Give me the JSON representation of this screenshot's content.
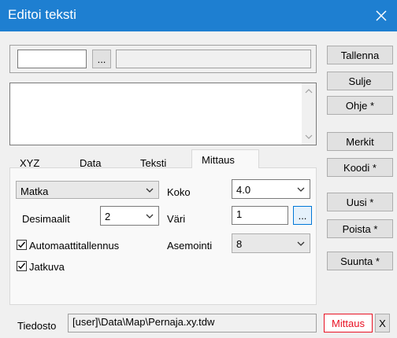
{
  "window": {
    "title": "Editoi teksti",
    "close": "✕"
  },
  "top": {
    "text_value": "",
    "browse": "...",
    "readonly_value": ""
  },
  "editor": {
    "value": ""
  },
  "tabs": [
    "XYZ",
    "Data",
    "Teksti",
    "Mittaus"
  ],
  "active_tab": "Mittaus",
  "mittaus": {
    "type_value": "Matka",
    "koko_label": "Koko",
    "koko_value": "4.0",
    "desimaalit_label": "Desimaalit",
    "desimaalit_value": "2",
    "vari_label": "Väri",
    "vari_value": "1",
    "vari_browse": "...",
    "asemointi_label": "Asemointi",
    "asemointi_value": "8",
    "auto_label": "Automaattitallennus",
    "auto_checked": true,
    "jatkuva_label": "Jatkuva",
    "jatkuva_checked": true
  },
  "buttons": {
    "tallenna": "Tallenna",
    "sulje": "Sulje",
    "ohje": "Ohje *",
    "merkit": "Merkit",
    "koodi": "Koodi *",
    "uusi": "Uusi *",
    "poista": "Poista *",
    "suunta": "Suunta *"
  },
  "footer": {
    "label": "Tiedosto",
    "path": "[user]\\Data\\Map\\Pernaja.xy.tdw",
    "mode": "Mittaus",
    "mode_color": "#e81123",
    "close": "X"
  },
  "colors": {
    "titlebar": "#1e7fd1",
    "focus": "#0078d7"
  }
}
